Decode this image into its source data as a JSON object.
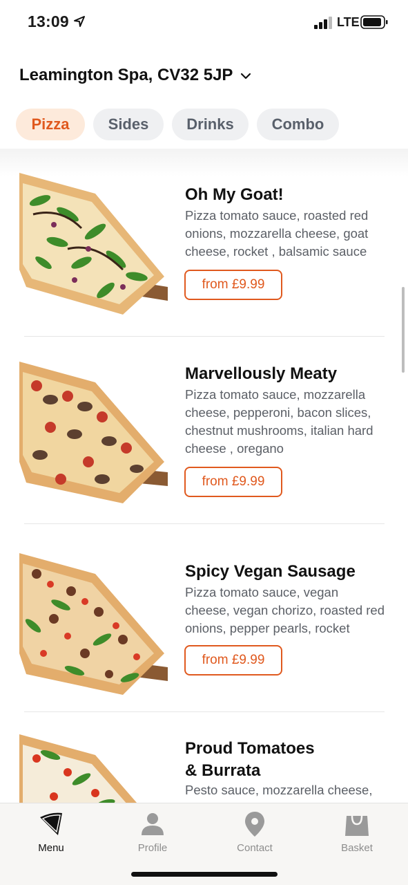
{
  "status_bar": {
    "time": "13:09",
    "network": "LTE"
  },
  "location": {
    "label": "Leamington Spa, CV32 5JP"
  },
  "tabs": [
    {
      "label": "Pizza",
      "active": true
    },
    {
      "label": "Sides",
      "active": false
    },
    {
      "label": "Drinks",
      "active": false
    },
    {
      "label": "Combo",
      "active": false
    }
  ],
  "items": [
    {
      "name": "Oh My Goat!",
      "description": "Pizza tomato sauce, roasted red onions, mozzarella cheese, goat cheese, rocket , balsamic sauce",
      "price": "from £9.99"
    },
    {
      "name": "Marvellously Meaty",
      "description": "Pizza tomato sauce, mozzarella cheese, pepperoni, bacon slices, chestnut mushrooms, italian hard cheese , oregano",
      "price": "from £9.99"
    },
    {
      "name": "Spicy Vegan Sausage",
      "description": "Pizza tomato sauce, vegan cheese, vegan chorizo, roasted red onions, pepper pearls, rocket",
      "price": "from £9.99"
    },
    {
      "name_line1": "Proud Tomatoes",
      "name_line2": "& Burrata",
      "description": "Pesto sauce, mozzarella cheese,"
    }
  ],
  "nav": [
    {
      "label": "Menu",
      "icon": "pizza-slice-icon",
      "active": true
    },
    {
      "label": "Profile",
      "icon": "person-icon",
      "active": false
    },
    {
      "label": "Contact",
      "icon": "map-pin-icon",
      "active": false
    },
    {
      "label": "Basket",
      "icon": "shopping-bag-icon",
      "active": false
    }
  ],
  "colors": {
    "accent": "#e0591e",
    "accent_bg": "#fdeadb",
    "tab_bg": "#eff0f2"
  }
}
